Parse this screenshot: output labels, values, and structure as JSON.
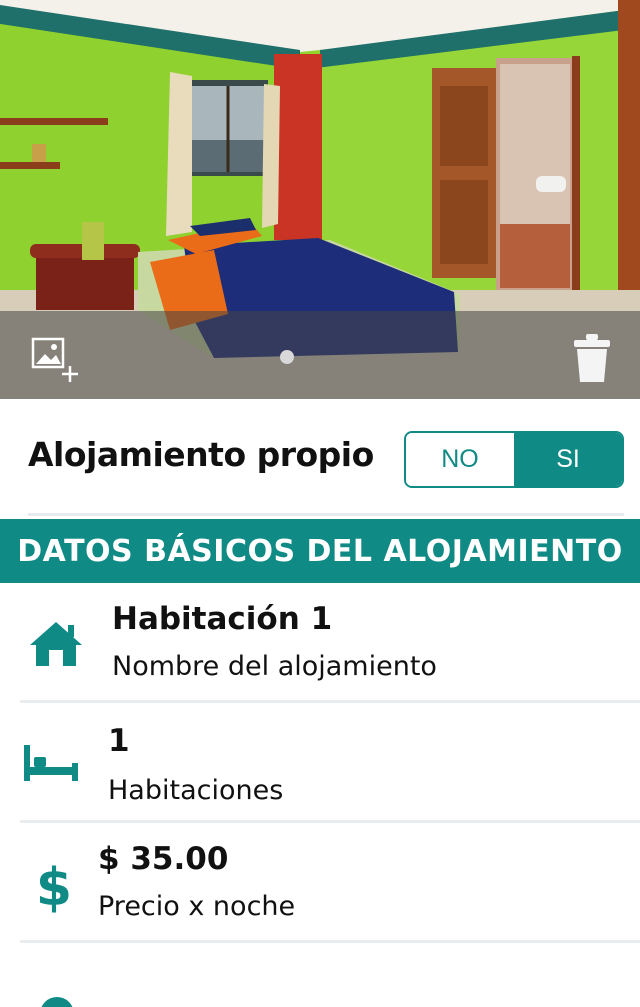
{
  "photo": {
    "alt": "Room photo",
    "add_photo_icon": "add-image-icon",
    "delete_icon": "trash-icon",
    "page_indicator_count": 1
  },
  "own_accommodation": {
    "label": "Alojamiento propio",
    "options": [
      "NO",
      "SI"
    ],
    "selected": "SI"
  },
  "section": {
    "title": "DATOS BÁSICOS DEL ALOJAMIENTO"
  },
  "fields": {
    "name": {
      "value": "Habitación 1",
      "label": "Nombre del alojamiento",
      "icon": "house-icon"
    },
    "rooms": {
      "value": "1",
      "label": "Habitaciones",
      "icon": "bed-icon"
    },
    "price": {
      "value": "$ 35.00",
      "label": "Precio x noche",
      "icon": "dollar-icon"
    }
  },
  "colors": {
    "accent": "#0f8a85",
    "divider": "#e8ecef"
  }
}
